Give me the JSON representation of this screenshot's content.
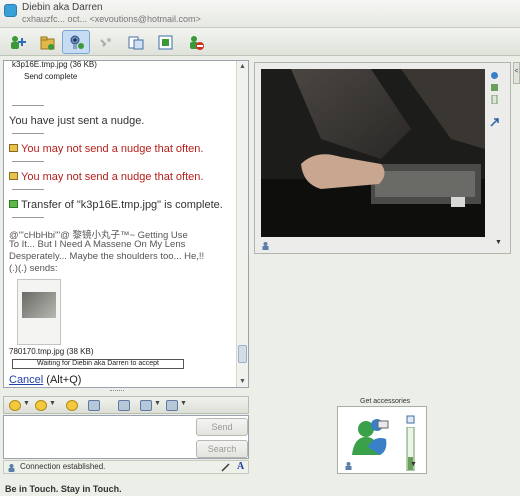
{
  "window": {
    "contact_name": "Diebin aka Darren",
    "contact_subtitle": "cxhauzfc... oct... <xevoutions@hotmail.com>"
  },
  "toolbar": {
    "buttons": [
      {
        "name": "invite-icon"
      },
      {
        "name": "send-files-icon"
      },
      {
        "name": "webcam-icon",
        "active": true
      },
      {
        "name": "audio-icon"
      },
      {
        "name": "activities-icon"
      },
      {
        "name": "games-icon"
      },
      {
        "name": "block-icon"
      }
    ]
  },
  "chat": {
    "file_top": "k3p16E.tmp.jpg (36 KB)",
    "send_complete": "Send complete",
    "msg_nudge_sent": "You have just sent a nudge.",
    "msg_nudge_limit": "You may not send a nudge that often.",
    "msg_transfer": "Transfer of \"k3p16E.tmp.jpg\" is complete.",
    "sender_line1": "@\"'cHbHbi'\"@ 黎镜小丸子™~ Getting Use",
    "sender_line2": "To It... But I Need A Massene On My Lens",
    "sender_line3": "Desperately... Maybe the shoulders too... He,!!",
    "sender_line4": "(.)(.) sends:",
    "thumb_caption": "780170.tmp.jpg (38 KB)",
    "waiting_text": "Waiting for Diebin aka Darren to accept",
    "cancel_link": "Cancel",
    "cancel_shortcut": " (Alt+Q)"
  },
  "compose": {
    "send_label": "Send",
    "search_label": "Search"
  },
  "status": {
    "text": "Connection established."
  },
  "accessories": {
    "label": "Get accessories"
  },
  "footer": {
    "text": "Be in Touch. Stay in Touch."
  },
  "colors": {
    "error_text": "#b3201c",
    "active_button": "#c6dcf2",
    "window_bg": "#eceee8"
  }
}
